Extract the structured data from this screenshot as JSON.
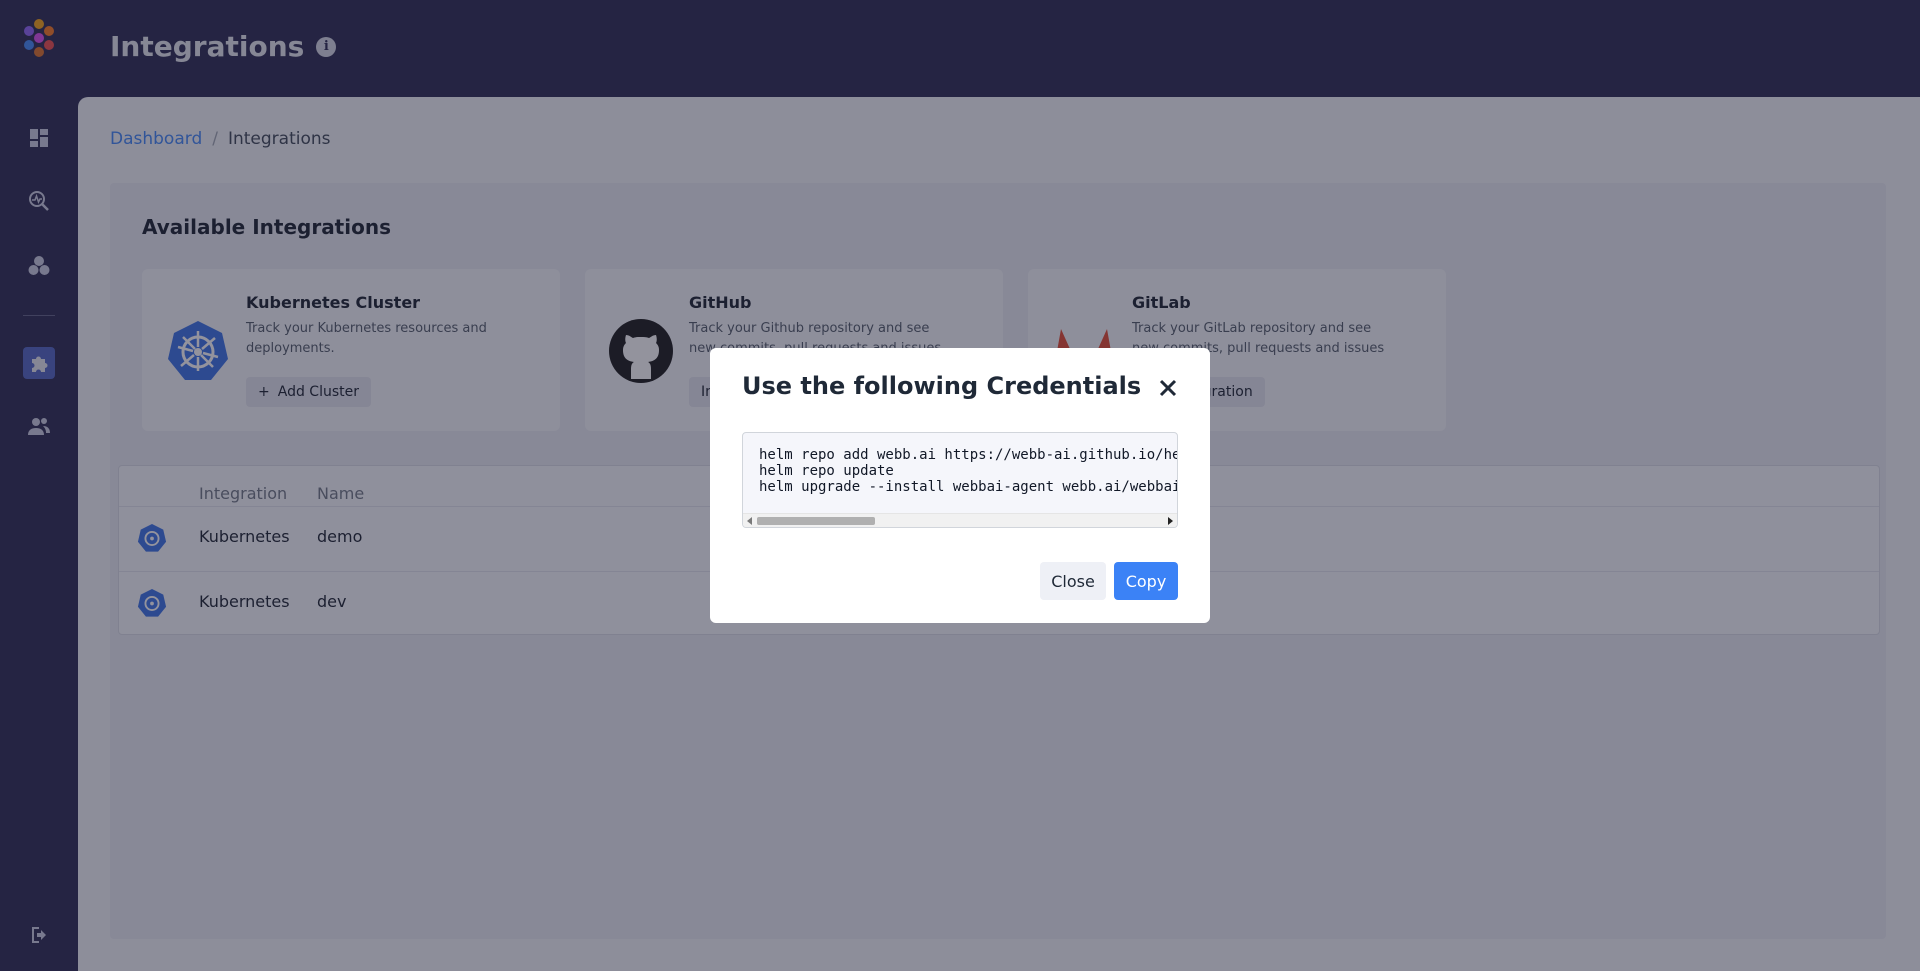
{
  "header": {
    "title": "Integrations",
    "info_icon": "info-icon"
  },
  "sidebar": {
    "items": [
      {
        "icon": "dashboard-icon"
      },
      {
        "icon": "investigate-icon"
      },
      {
        "icon": "services-icon"
      },
      {
        "icon": "integrations-icon",
        "active": true
      },
      {
        "icon": "users-icon"
      }
    ],
    "logout_icon": "logout-icon"
  },
  "breadcrumb": {
    "home": "Dashboard",
    "separator": "/",
    "current": "Integrations"
  },
  "available": {
    "title": "Available Integrations",
    "cards": [
      {
        "name": "Kubernetes Cluster",
        "desc": "Track your Kubernetes resources and deployments.",
        "button": "Add Cluster",
        "button_icon": "+"
      },
      {
        "name": "GitHub",
        "desc": "Track your Github repository and see new commits, pull requests and issues",
        "button": "Install"
      },
      {
        "name": "GitLab",
        "desc": "Track your GitLab repository and see new commits, pull requests and issues",
        "button": "Add Integration"
      }
    ]
  },
  "table": {
    "headers": {
      "integration": "Integration",
      "name": "Name"
    },
    "rows": [
      {
        "integration": "Kubernetes",
        "name": "demo"
      },
      {
        "integration": "Kubernetes",
        "name": "dev"
      }
    ]
  },
  "modal": {
    "title": "Use the following Credentials",
    "code": [
      "helm repo add webb.ai https://webb-ai.github.io/helm-charts",
      "helm repo update",
      "helm upgrade --install webbai-agent webb.ai/webbai-agent"
    ],
    "close_label": "Close",
    "copy_label": "Copy"
  },
  "colors": {
    "sidebar": "#22214a",
    "accent": "#3b82f6",
    "kubernetes": "#326ce5",
    "gitlab": "#e24329"
  }
}
